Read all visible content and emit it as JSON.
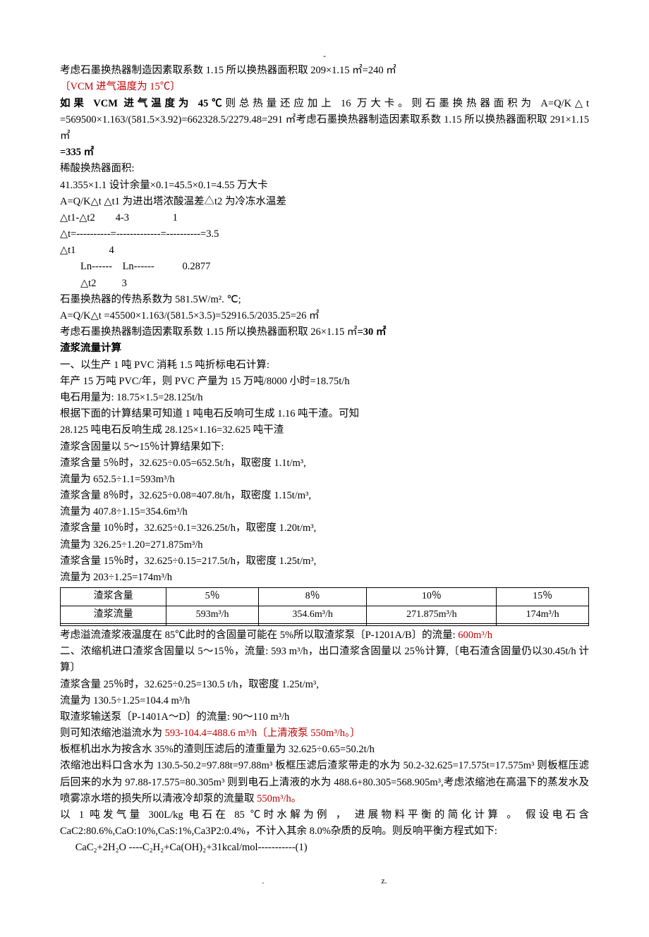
{
  "header_dash": "-",
  "p1": "考虑石墨换热器制造因素取系数 1.15 所以换热器面积取 209×1.15 ㎡=240 ㎡",
  "p2": "〔VCM 进气温度为 15℃〕",
  "p3a": "如果 VCM 进气温度为 45℃",
  "p3b": "则总热量还应加上 16 万大卡。则石墨换热器面积为 A=Q/K△t  =569500×1.163/(581.5×3.92)=662328.5/2279.48=291 ㎡考虑石墨换热器制造因素取系数 1.15 所以换热器面积取 291×1.15 ㎡",
  "p3c": "=335 ㎡",
  "p4": "稀酸换热器面积:",
  "p5": "41.355×1.1 设计余量×0.1=45.5×0.1=4.55 万大卡",
  "p6": "A=Q/K△t   △t1 为进出塔浓酸温差△t2 为冷冻水温差",
  "p7": "△t1-△t2        4-3                 1",
  "p8": "△t=----------=-------------=----------=3.5",
  "p9": "△t1             4",
  "p10": "        Ln------    Ln------           0.2877",
  "p11": "        △t2          3",
  "p12": "石墨换热器的传热系数为 581.5W/m². ℃;",
  "p13": "A=Q/K△t   =45500×1.163/(581.5×3.5)=52916.5/2035.25=26 ㎡",
  "p14": "考虑石墨换热器制造因素取系数 1.15 所以换热器面积取 26×1.15 ㎡=30 ㎡",
  "h1": "渣浆流量计算",
  "p15": "一、以生产 1 吨 PVC 消耗 1.5 吨折标电石计算:",
  "p16": "年产 15 万吨 PVC/年，则 PVC 产量为 15 万吨/8000 小时=18.75t/h",
  "p17": "电石用量为: 18.75×1.5=28.125t/h",
  "p18": "根据下面的计算结果可知道 1 吨电石反响可生成 1.16 吨干渣。可知",
  "p19": "28.125 吨电石反响生成 28.125×1.16=32.625 吨干渣",
  "p20": "渣浆含固量以 5～15％计算结果如下:",
  "p21": "渣浆含量 5％时，32.625÷0.05=652.5t/h，取密度 1.1t/m³,",
  "p22": "流量为 652.5÷1.1=593m³/h",
  "p23": "渣浆含量 8％时，32.625÷0.08=407.8t/h，取密度 1.15t/m³,",
  "p24": "流量为 407.8÷1.15=354.6m³/h",
  "p25": "渣浆含量 10％时，32.625÷0.1=326.25t/h，取密度 1.20t/m³,",
  "p26": "流量为 326.25÷1.20=271.875m³/h",
  "p27": "渣浆含量 15％时，32.625÷0.15=217.5t/h，取密度 1.25t/m³,",
  "p28": "流量为 203÷1.25=174m³/h",
  "table": {
    "r1": {
      "c1": "渣浆含量",
      "c2": "5％",
      "c3": "8％",
      "c4": "10％",
      "c5": "15％"
    },
    "r2": {
      "c1": "渣浆流量",
      "c2": "593m³/h",
      "c3": "354.6m³/h",
      "c4": "271.875m³/h",
      "c5": "174m³/h"
    },
    "r3": {
      "c1": "",
      "c2": "",
      "c3": "",
      "c4": "",
      "c5": ""
    }
  },
  "p29a": "考虑溢流渣浆液温度在 85℃此时的含固量可能在 5%所以取渣浆泵〔P-1201A/B〕的流量:  ",
  "p29b": "600m³/h",
  "p30": "二、浓缩机进口渣浆含固量以 5～15％，流量: 593 m³/h，出口渣浆含固量以 25％计算,〔电石渣含固量仍以30.45t/h 计算〕",
  "p31": "渣浆含量 25％时，32.625÷0.25=130.5 t/h，取密度 1.25t/m³,",
  "p32": "流量为 130.5÷1.25=104.4 m³/h",
  "p33": "取渣浆输送泵〔P-1401A～D〕的流量: 90～110 m³/h",
  "p34a": "则可知浓缩池溢流水为 ",
  "p34b": "593-104.4=488.6 m³/h〔上清液泵 550m³/h。〕",
  "p35": "板框机出水为按含水 35%的渣则压滤后的渣重量为 32.625÷0.65=50.2t/h",
  "p36a": "浓缩池出料口含水为 130.5-50.2=97.88t=97.88m³ 板框压滤后渣浆带走的水为 50.2-32.625=17.575t=17.575m³ 则板框压滤后回来的水为 97.88-17.575=80.305m³ 则到电石上清液的水为 488.6+80.305=568.905m³,考虑浓缩池在高温下的蒸发水及喷雾凉水塔的损失所以清液冷却泵的流量取 ",
  "p36b": "550m³/h。",
  "p37": "以 1 吨发气量 300L/kg 电石在 85 ℃时水解为例 ， 进展物料平衡的简化计算 。 假设电石含CaC2:80.6%,CaO:10%,CaS:1%,Ca3P2:0.4%，不计入其余 8.0%杂质的反响。则反响平衡方程式如下:",
  "p38": "CaC₂+2H₂O ----C₂H₂+Ca(OH)₂+31kcal/mol-----------(1)",
  "footer_left": ".",
  "footer_right": "z."
}
